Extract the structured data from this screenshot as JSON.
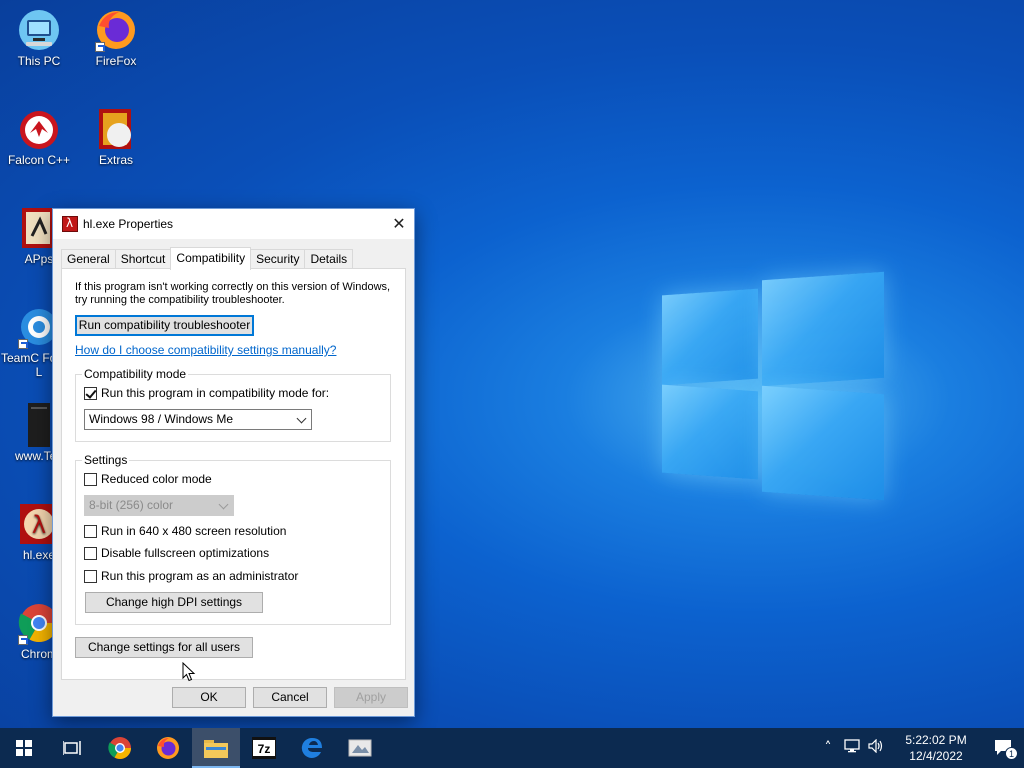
{
  "desktop": {
    "icons": [
      {
        "label": "This PC"
      },
      {
        "label": "FireFox"
      },
      {
        "label": "Falcon C++"
      },
      {
        "label": "Extras"
      },
      {
        "label": "APps"
      },
      {
        "label": "TeamC Forum L"
      },
      {
        "label": "www.Tea"
      },
      {
        "label": "hl.exe"
      },
      {
        "label": "Chrom"
      }
    ]
  },
  "dialog": {
    "title": "hl.exe Properties",
    "tabs": [
      "General",
      "Shortcut",
      "Compatibility",
      "Security",
      "Details"
    ],
    "active_tab": "Compatibility",
    "info_line1": "If this program isn't working correctly on this version of Windows,",
    "info_line2": "try running the compatibility troubleshooter.",
    "troubleshooter_button": "Run compatibility troubleshooter",
    "manual_link": "How do I choose compatibility settings manually?",
    "compat_group": {
      "legend": "Compatibility mode",
      "checkbox_label": "Run this program in compatibility mode for:",
      "checked": true,
      "selected_os": "Windows 98 / Windows Me"
    },
    "settings_group": {
      "legend": "Settings",
      "reduced_color": {
        "label": "Reduced color mode",
        "checked": false
      },
      "color_select": "8-bit (256) color",
      "res_640": {
        "label": "Run in 640 x 480 screen resolution",
        "checked": false
      },
      "disable_fullscreen": {
        "label": "Disable fullscreen optimizations",
        "checked": false
      },
      "run_admin": {
        "label": "Run this program as an administrator",
        "checked": false
      },
      "dpi_button": "Change high DPI settings"
    },
    "all_users_button": "Change settings for all users",
    "ok": "OK",
    "cancel": "Cancel",
    "apply": "Apply"
  },
  "taskbar": {
    "time": "5:22:02 PM",
    "date": "12/4/2022",
    "notification_count": "1",
    "apps": [
      "start-icon",
      "task-view-icon",
      "chrome-icon",
      "firefox-icon",
      "file-explorer-icon",
      "7zip-icon",
      "edge-icon",
      "app-icon"
    ]
  },
  "colors": {
    "accent": "#0078d7",
    "link": "#0066cc",
    "taskbar": "#0c2a50"
  }
}
